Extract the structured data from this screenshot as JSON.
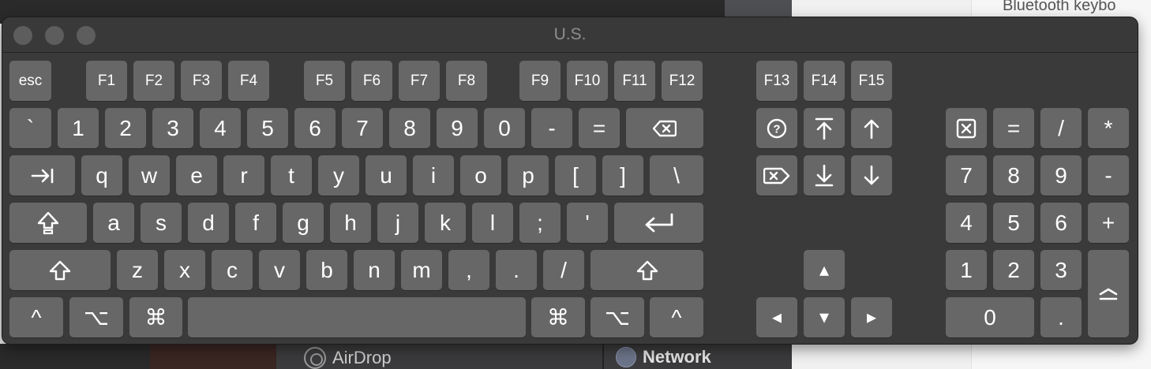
{
  "background": {
    "bluetooth_text": "Bluetooth keybo",
    "airdrop_label": "AirDrop",
    "network_label": "Network"
  },
  "window": {
    "title": "U.S."
  },
  "keys": {
    "esc": "esc",
    "f1": "F1",
    "f2": "F2",
    "f3": "F3",
    "f4": "F4",
    "f5": "F5",
    "f6": "F6",
    "f7": "F7",
    "f8": "F8",
    "f9": "F9",
    "f10": "F10",
    "f11": "F11",
    "f12": "F12",
    "f13": "F13",
    "f14": "F14",
    "f15": "F15",
    "backtick": "`",
    "n1": "1",
    "n2": "2",
    "n3": "3",
    "n4": "4",
    "n5": "5",
    "n6": "6",
    "n7": "7",
    "n8": "8",
    "n9": "9",
    "n0": "0",
    "minus": "-",
    "equals": "=",
    "q": "q",
    "w": "w",
    "e": "e",
    "r": "r",
    "t": "t",
    "y": "y",
    "u": "u",
    "i": "i",
    "o": "o",
    "p": "p",
    "lbracket": "[",
    "rbracket": "]",
    "backslash": "\\",
    "a": "a",
    "s": "s",
    "d": "d",
    "f": "f",
    "g": "g",
    "h": "h",
    "j": "j",
    "k": "k",
    "l": "l",
    "semicolon": ";",
    "quote": "'",
    "z": "z",
    "x": "x",
    "c": "c",
    "v": "v",
    "b": "b",
    "n": "n",
    "m": "m",
    "comma": ",",
    "period": ".",
    "slash": "/",
    "control": "^",
    "option": "⌥",
    "command": "⌘",
    "nav_up_small": "▴",
    "nav_left_small": "◂",
    "nav_down_small": "▾",
    "nav_right_small": "▸",
    "kp_equals": "=",
    "kp_divide": "/",
    "kp_multiply": "*",
    "kp7": "7",
    "kp8": "8",
    "kp9": "9",
    "kp_minus": "-",
    "kp4": "4",
    "kp5": "5",
    "kp6": "6",
    "kp_plus": "+",
    "kp1": "1",
    "kp2": "2",
    "kp3": "3",
    "kp0": "0",
    "kp_decimal": "."
  },
  "icons": {
    "delete": "delete-backward-icon",
    "tab": "tab-icon",
    "capslock": "caps-lock-icon",
    "return": "return-icon",
    "shift": "shift-icon",
    "help": "help-icon",
    "home": "home-icon",
    "pageup": "page-up-icon",
    "forward_delete": "forward-delete-icon",
    "end": "end-icon",
    "pagedown": "page-down-icon",
    "clear": "clear-icon",
    "enter": "enter-icon"
  },
  "colors": {
    "window_bg": "#3a3a3a",
    "key_bg": "#676767",
    "key_text": "#ffffff",
    "title_text": "#8e8e8e"
  }
}
